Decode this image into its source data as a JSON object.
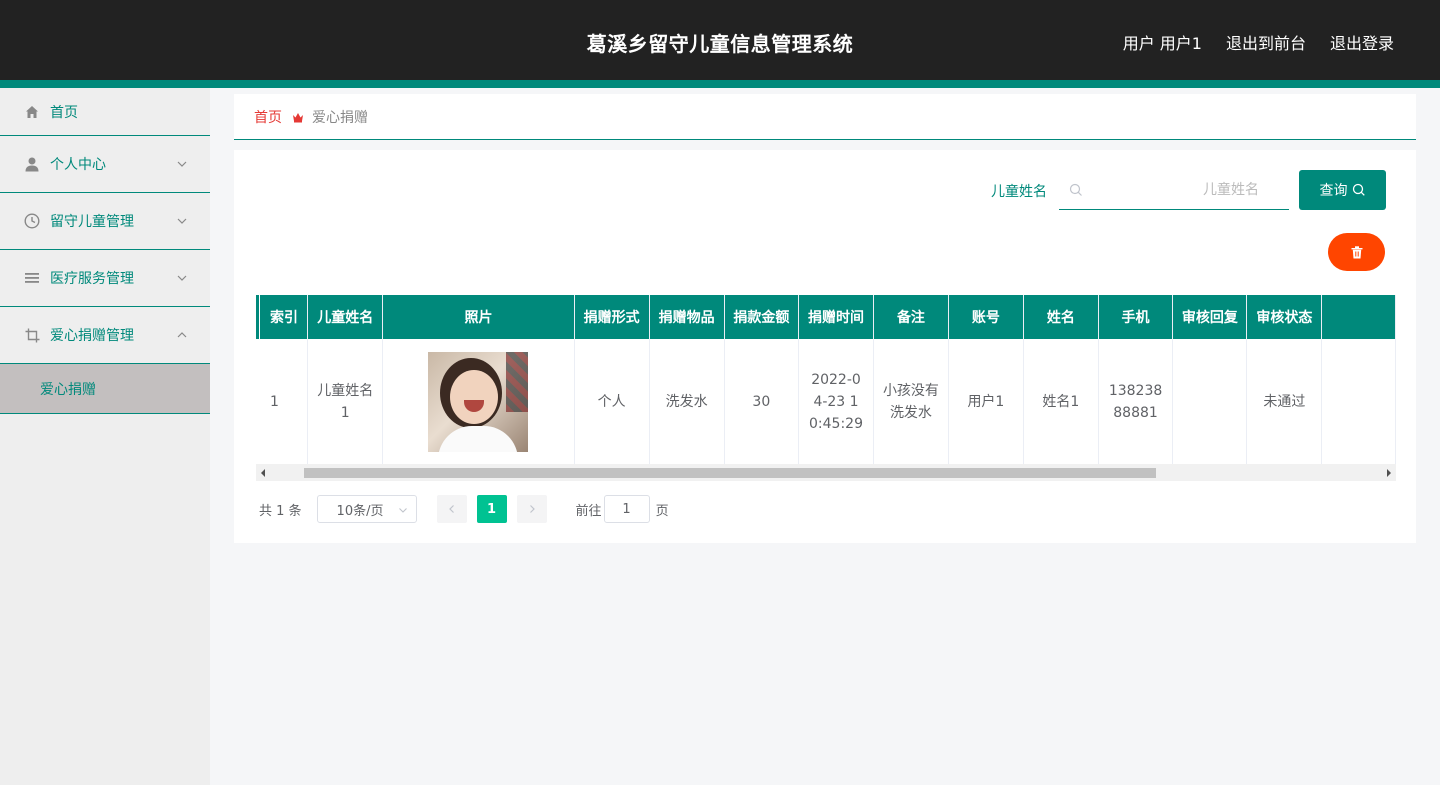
{
  "header": {
    "title": "葛溪乡留守儿童信息管理系统",
    "user_label": "用户 用户1",
    "front_link": "退出到前台",
    "logout_link": "退出登录"
  },
  "sidebar": {
    "items": [
      {
        "label": "首页",
        "icon": "home-icon"
      },
      {
        "label": "个人中心",
        "icon": "user-icon",
        "expandable": true
      },
      {
        "label": "留守儿童管理",
        "icon": "clock-icon",
        "expandable": true
      },
      {
        "label": "医疗服务管理",
        "icon": "list-icon",
        "expandable": true
      },
      {
        "label": "爱心捐赠管理",
        "icon": "crop-icon",
        "expandable": true,
        "expanded": true
      }
    ],
    "sub_items": [
      {
        "label": "爱心捐赠",
        "active": true
      }
    ]
  },
  "breadcrumb": {
    "home": "首页",
    "current": "爱心捐赠"
  },
  "search": {
    "label": "儿童姓名",
    "placeholder": "儿童姓名",
    "value": "",
    "button_label": "查询"
  },
  "table": {
    "columns": [
      "索引",
      "儿童姓名",
      "照片",
      "捐赠形式",
      "捐赠物品",
      "捐款金额",
      "捐赠时间",
      "备注",
      "账号",
      "姓名",
      "手机",
      "审核回复",
      "审核状态"
    ],
    "rows": [
      {
        "index": "1",
        "child_name": "儿童姓名1",
        "photo": "photo-image",
        "donation_form": "个人",
        "donation_item": "洗发水",
        "amount": "30",
        "time": "2022-04-23 10:45:29",
        "remark": "小孩没有洗发水",
        "account": "用户1",
        "name": "姓名1",
        "phone": "13823888881",
        "review_reply": "",
        "review_status": "未通过"
      }
    ]
  },
  "pagination": {
    "total": "共 1 条",
    "page_size": "10条/页",
    "current_page": "1",
    "goto_label": "前往",
    "goto_value": "1",
    "goto_suffix": "页"
  },
  "colors": {
    "primary": "#00897b",
    "header_bg": "#222222",
    "danger": "#ff4500",
    "page_active": "#00c292",
    "breadcrumb_home": "#e53935"
  }
}
